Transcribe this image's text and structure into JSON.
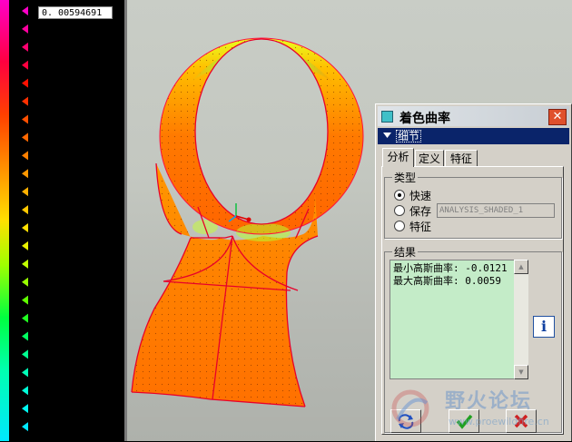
{
  "legend": {
    "max_value": "0. 00594691",
    "gradient_colors": [
      "#ff00c8",
      "#ff0040",
      "#ff4000",
      "#ff9000",
      "#ffe000",
      "#a0ff00",
      "#00ff40",
      "#00ffb0",
      "#00e8ff"
    ],
    "tick_colors": [
      "#ff00c8",
      "#ff00a0",
      "#ff0070",
      "#ff0040",
      "#ff1000",
      "#ff3000",
      "#ff5000",
      "#ff6800",
      "#ff8000",
      "#ff9800",
      "#ffb000",
      "#ffc800",
      "#ffe000",
      "#e8f000",
      "#c0ff00",
      "#98ff00",
      "#60ff00",
      "#20ff20",
      "#00ff60",
      "#00ff90",
      "#00ffb8",
      "#00ffd8",
      "#00f8f0",
      "#00e8ff"
    ]
  },
  "dialog": {
    "title": "着色曲率",
    "section_label": "细节",
    "tabs": [
      "分析",
      "定义",
      "特征"
    ],
    "type_group": {
      "title": "类型",
      "options": [
        "快速",
        "保存",
        "特征"
      ],
      "selected": "快速",
      "analysis_name": "ANALYSIS_SHADED_1"
    },
    "result_group": {
      "title": "结果",
      "lines": [
        "最小高斯曲率: -0.0121",
        "最大高斯曲率: 0.0059"
      ]
    }
  },
  "watermark": {
    "name": "野火论坛",
    "url": "www.proewildfire.cn"
  },
  "colors": {
    "title_active": "#0a246a",
    "result_bg": "#c4ecc8",
    "close": "#e0502c"
  }
}
